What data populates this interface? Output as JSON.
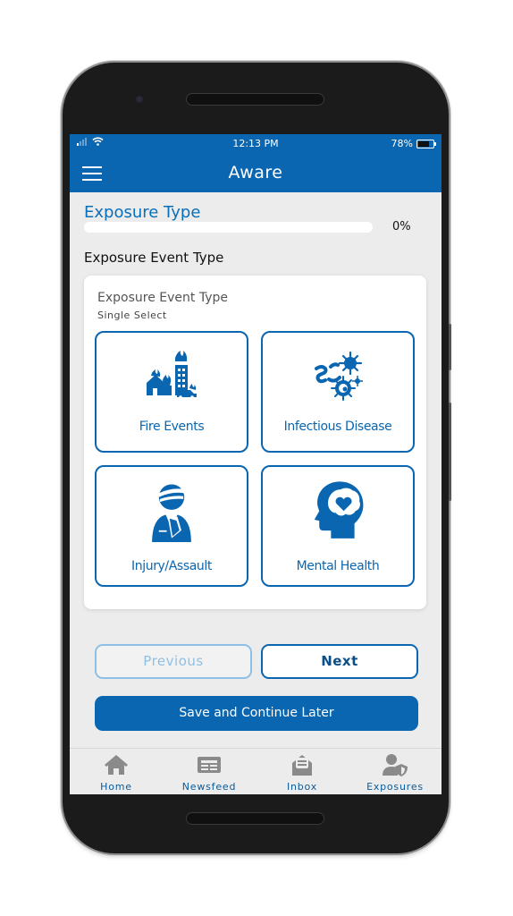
{
  "status_bar": {
    "time": "12:13 PM",
    "battery": "78%"
  },
  "app_bar": {
    "title": "Aware"
  },
  "section": {
    "title": "Exposure Type",
    "progress_percent": 0,
    "progress_label": "0%"
  },
  "question": {
    "title": "Exposure Event Type",
    "card_title": "Exposure Event Type",
    "select_mode": "Single Select",
    "options": [
      {
        "label": "Fire Events",
        "icon": "fire-buildings-icon"
      },
      {
        "label": "Infectious Disease",
        "icon": "germs-icon"
      },
      {
        "label": "Injury/Assault",
        "icon": "injured-person-icon"
      },
      {
        "label": "Mental Health",
        "icon": "head-heart-icon"
      }
    ]
  },
  "buttons": {
    "previous": "Previous",
    "next": "Next",
    "save": "Save and Continue Later"
  },
  "tabbar": {
    "items": [
      {
        "label": "Home",
        "icon": "home-icon"
      },
      {
        "label": "Newsfeed",
        "icon": "newspaper-icon"
      },
      {
        "label": "Inbox",
        "icon": "inbox-icon"
      },
      {
        "label": "Exposures",
        "icon": "user-shield-icon"
      }
    ]
  },
  "colors": {
    "primary": "#0a66b0",
    "disabled": "#8ec0e6",
    "tab_icon": "#8a8a8a"
  }
}
